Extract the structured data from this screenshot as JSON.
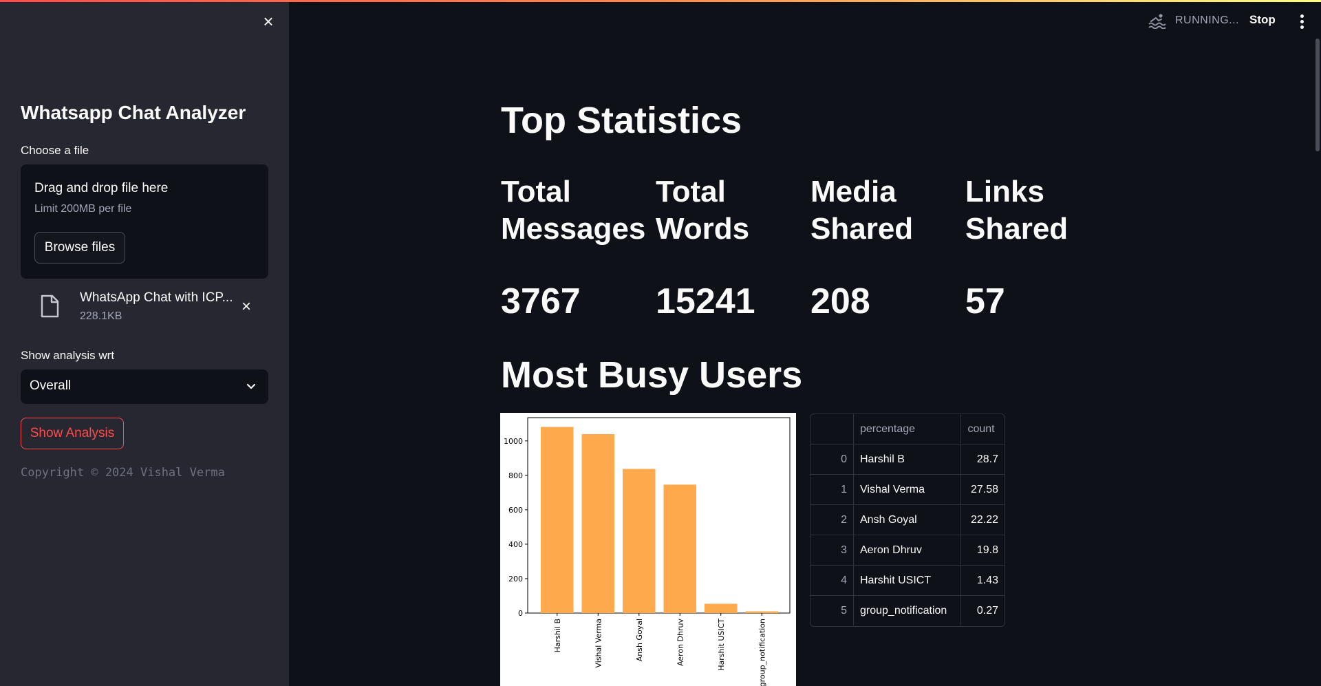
{
  "sidebar": {
    "title": "Whatsapp Chat Analyzer",
    "file_label": "Choose a file",
    "dropzone_title": "Drag and drop file here",
    "dropzone_limit": "Limit 200MB per file",
    "browse_label": "Browse files",
    "file_name": "WhatsApp Chat with ICP...",
    "file_size": "228.1KB",
    "select_label": "Show analysis wrt",
    "select_value": "Overall",
    "analysis_button": "Show Analysis",
    "copyright": "Copyright © 2024 Vishal Verma"
  },
  "header": {
    "status": "RUNNING...",
    "stop_label": "Stop"
  },
  "main": {
    "title": "Top Statistics",
    "stats": [
      {
        "label": "Total Messages",
        "value": "3767"
      },
      {
        "label": "Total Words",
        "value": "15241"
      },
      {
        "label": "Media Shared",
        "value": "208"
      },
      {
        "label": "Links Shared",
        "value": "57"
      }
    ],
    "busy_title": "Most Busy Users",
    "table": {
      "columns": [
        "",
        "percentage",
        "count"
      ],
      "rows": [
        {
          "index": "0",
          "name": "Harshil B",
          "value": "28.7"
        },
        {
          "index": "1",
          "name": "Vishal Verma",
          "value": "27.58"
        },
        {
          "index": "2",
          "name": "Ansh Goyal",
          "value": "22.22"
        },
        {
          "index": "3",
          "name": "Aeron Dhruv",
          "value": "19.8"
        },
        {
          "index": "4",
          "name": "Harshit USICT",
          "value": "1.43"
        },
        {
          "index": "5",
          "name": "group_notification",
          "value": "0.27"
        }
      ]
    }
  },
  "colors": {
    "accent": "#ff4b4b",
    "bar": "#ffa94d",
    "sidebar_bg": "#262730",
    "main_bg": "#0e1117"
  },
  "chart_data": {
    "type": "bar",
    "categories": [
      "Harshil B",
      "Vishal Verma",
      "Ansh Goyal",
      "Aeron Dhruv",
      "Harshit USICT",
      "group_notification"
    ],
    "values": [
      1081,
      1039,
      837,
      746,
      54,
      10
    ],
    "yticks": [
      0,
      200,
      400,
      600,
      800,
      1000
    ],
    "ylim": [
      0,
      1135
    ],
    "title": "",
    "xlabel": "",
    "ylabel": ""
  }
}
